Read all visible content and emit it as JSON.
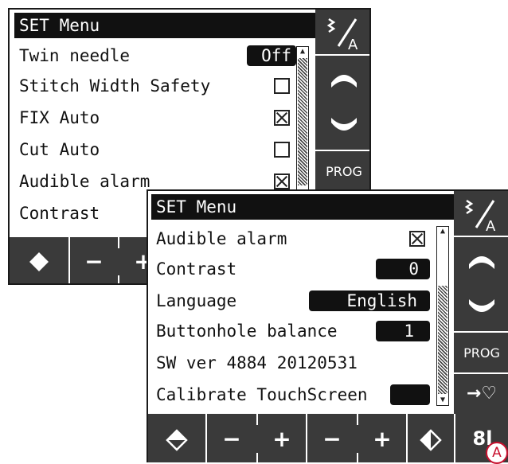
{
  "screen_back": {
    "title": "SET Menu",
    "rows": [
      {
        "label": "Twin needle",
        "value": "Off"
      },
      {
        "label": "Stitch Width Safety",
        "checked": false
      },
      {
        "label": "FIX Auto",
        "checked": true
      },
      {
        "label": "Cut Auto",
        "checked": false
      },
      {
        "label": "Audible alarm",
        "checked": true
      },
      {
        "label": "Contrast"
      }
    ],
    "side": {
      "prog_label": "PROG"
    },
    "bottom": {
      "minus": "−",
      "plus": "+"
    }
  },
  "screen_front": {
    "title": "SET Menu",
    "rows": [
      {
        "label": "Audible alarm",
        "checked": true
      },
      {
        "label": "Contrast",
        "value": "0"
      },
      {
        "label": "Language",
        "value": "English"
      },
      {
        "label": "Buttonhole balance",
        "value": "1"
      },
      {
        "label": "SW ver 4884 20120531"
      },
      {
        "label": "Calibrate TouchScreen",
        "value": ""
      }
    ],
    "side": {
      "prog_label": "PROG",
      "heart_label": "→♡"
    },
    "bottom": {
      "minus1": "−",
      "plus1": "+",
      "minus2": "−",
      "plus2": "+",
      "tools": "8l"
    },
    "callout": "A"
  },
  "colors": {
    "panel_dark": "#3a3a3a",
    "title_bg": "#111111",
    "callout": "#c8102e"
  }
}
